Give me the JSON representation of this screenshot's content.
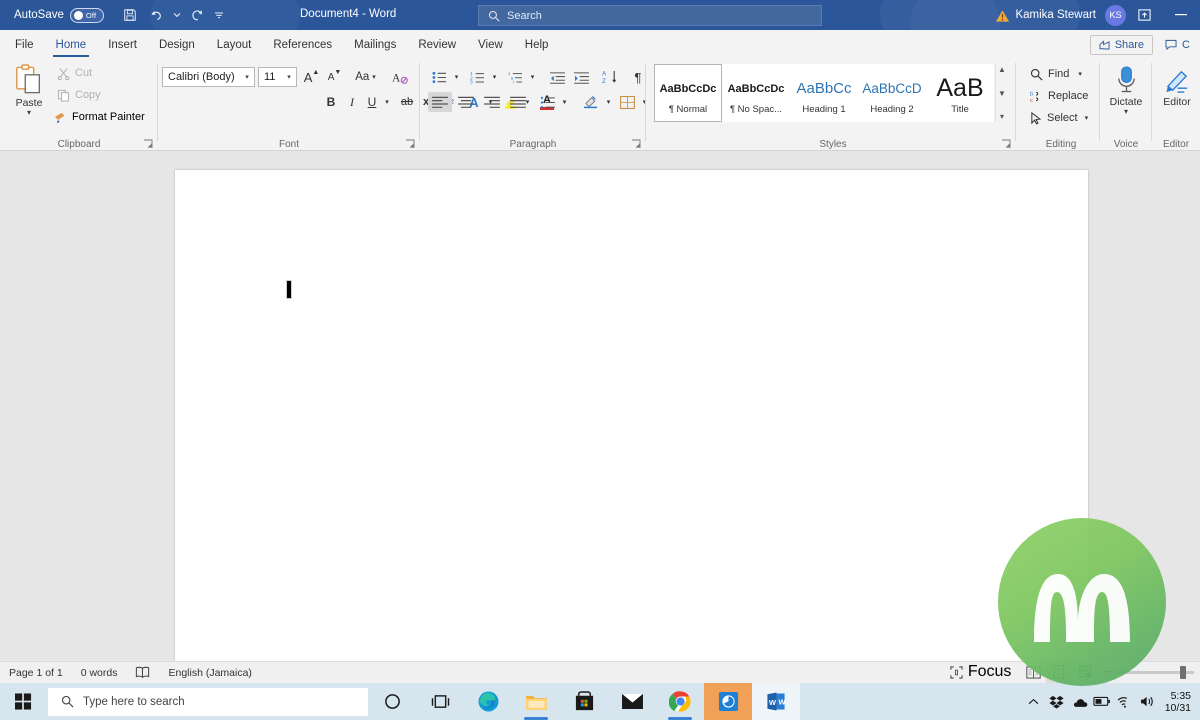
{
  "titlebar": {
    "autosave_label": "AutoSave",
    "autosave_state": "Off",
    "document_title": "Document4  -  Word",
    "quick_access": [
      {
        "name": "save-icon",
        "label": "Save"
      },
      {
        "name": "undo-icon",
        "label": "Undo"
      },
      {
        "name": "redo-icon",
        "label": "Redo"
      },
      {
        "name": "customize-qat-icon",
        "label": "Customize Quick Access Toolbar"
      }
    ],
    "search_placeholder": "Search",
    "warning_icon": "warning-triangle-icon",
    "user_name": "Kamika Stewart",
    "user_initials": "KS",
    "ribbon_display_icon": "ribbon-display-options-icon",
    "minimize_label": "Minimize",
    "accent_color": "#2b579a"
  },
  "tabs": [
    {
      "label": "File",
      "active": false
    },
    {
      "label": "Home",
      "active": true
    },
    {
      "label": "Insert",
      "active": false
    },
    {
      "label": "Design",
      "active": false
    },
    {
      "label": "Layout",
      "active": false
    },
    {
      "label": "References",
      "active": false
    },
    {
      "label": "Mailings",
      "active": false
    },
    {
      "label": "Review",
      "active": false
    },
    {
      "label": "View",
      "active": false
    },
    {
      "label": "Help",
      "active": false
    }
  ],
  "tabbar_right": {
    "share_label": "Share",
    "comments_label": "C"
  },
  "ribbon": {
    "groups": [
      {
        "name": "Clipboard"
      },
      {
        "name": "Font"
      },
      {
        "name": "Paragraph"
      },
      {
        "name": "Styles"
      },
      {
        "name": "Editing"
      },
      {
        "name": "Voice"
      },
      {
        "name": "Editor"
      }
    ],
    "clipboard": {
      "paste_label": "Paste",
      "cut_label": "Cut",
      "copy_label": "Copy",
      "format_painter_label": "Format Painter",
      "cut_disabled": true,
      "copy_disabled": true
    },
    "font": {
      "font_name": "Calibri (Body)",
      "font_size": "11",
      "grow_font_label": "A",
      "shrink_font_label": "A",
      "change_case_label": "Aa",
      "clear_formatting_label": "A",
      "bold_label": "B",
      "italic_label": "I",
      "underline_label": "U",
      "strikethrough_label": "ab",
      "subscript_label": "x",
      "superscript_label": "x",
      "text_effects_label": "A",
      "highlight_label": "A",
      "font_color_label": "A",
      "highlight_color": "#ffee00",
      "font_color": "#d32f2f"
    },
    "paragraph": {
      "bullets_label": "Bullets",
      "numbering_label": "Numbering",
      "multilevel_label": "Multilevel List",
      "decrease_indent_label": "Decrease Indent",
      "increase_indent_label": "Increase Indent",
      "sort_label": "Sort",
      "show_marks_label": "¶",
      "align_left_label": "Align Left",
      "align_center_label": "Center",
      "align_right_label": "Align Right",
      "justify_label": "Justify",
      "line_spacing_label": "Line Spacing",
      "shading_label": "Shading",
      "borders_label": "Borders",
      "align_left_active": true
    },
    "styles": [
      {
        "preview": "AaBbCcDc",
        "name": "¶ Normal",
        "selected": true,
        "color": "#1a1a1a",
        "size": 13
      },
      {
        "preview": "AaBbCcDc",
        "name": "¶ No Spac...",
        "selected": false,
        "color": "#1a1a1a",
        "size": 13
      },
      {
        "preview": "AaBbCс",
        "name": "Heading 1",
        "selected": false,
        "color": "#2e74b5",
        "size": 16
      },
      {
        "preview": "AaBbCcD",
        "name": "Heading 2",
        "selected": false,
        "color": "#2e74b5",
        "size": 14
      },
      {
        "preview": "AaB",
        "name": "Title",
        "selected": false,
        "color": "#1a1a1a",
        "size": 25
      }
    ],
    "editing": {
      "find_label": "Find",
      "replace_label": "Replace",
      "select_label": "Select"
    },
    "voice": {
      "dictate_label": "Dictate"
    },
    "editor": {
      "editor_label": "Editor"
    }
  },
  "document": {
    "caret_visible": true,
    "content": ""
  },
  "watermark": {
    "name": "green-m-logo-watermark",
    "color": "#7ec75f"
  },
  "statusbar": {
    "page_label": "Page 1 of 1",
    "word_count": "0 words",
    "proofing_icon": "proofing-errors-icon",
    "language": "English (Jamaica)",
    "focus_label": "Focus",
    "views": [
      {
        "name": "read-mode",
        "selected": false
      },
      {
        "name": "print-layout",
        "selected": true
      },
      {
        "name": "web-layout",
        "selected": false
      }
    ],
    "zoom_minus": "−"
  },
  "taskbar": {
    "start_label": "Start",
    "search_placeholder": "Type here to search",
    "apps": [
      {
        "name": "cortana-icon",
        "label": "Cortana",
        "state": "idle"
      },
      {
        "name": "task-view-icon",
        "label": "Task View",
        "state": "idle"
      },
      {
        "name": "edge-icon",
        "label": "Microsoft Edge",
        "state": "idle"
      },
      {
        "name": "file-explorer-icon",
        "label": "File Explorer",
        "state": "running"
      },
      {
        "name": "microsoft-store-icon",
        "label": "Microsoft Store",
        "state": "idle"
      },
      {
        "name": "mail-icon",
        "label": "Mail",
        "state": "idle"
      },
      {
        "name": "chrome-icon",
        "label": "Google Chrome",
        "state": "running"
      },
      {
        "name": "recorder-icon",
        "label": "Screen Recorder",
        "state": "active-highlight"
      },
      {
        "name": "word-icon",
        "label": "Microsoft Word",
        "state": "active"
      }
    ],
    "tray": [
      {
        "name": "show-hidden-icons-icon",
        "label": "Show hidden icons"
      },
      {
        "name": "dropbox-icon",
        "label": "Dropbox"
      },
      {
        "name": "onedrive-icon",
        "label": "OneDrive"
      },
      {
        "name": "battery-icon",
        "label": "Battery"
      },
      {
        "name": "wifi-icon",
        "label": "Network"
      },
      {
        "name": "volume-icon",
        "label": "Volume"
      }
    ],
    "clock_time": "5:35",
    "clock_date": "10/31"
  }
}
